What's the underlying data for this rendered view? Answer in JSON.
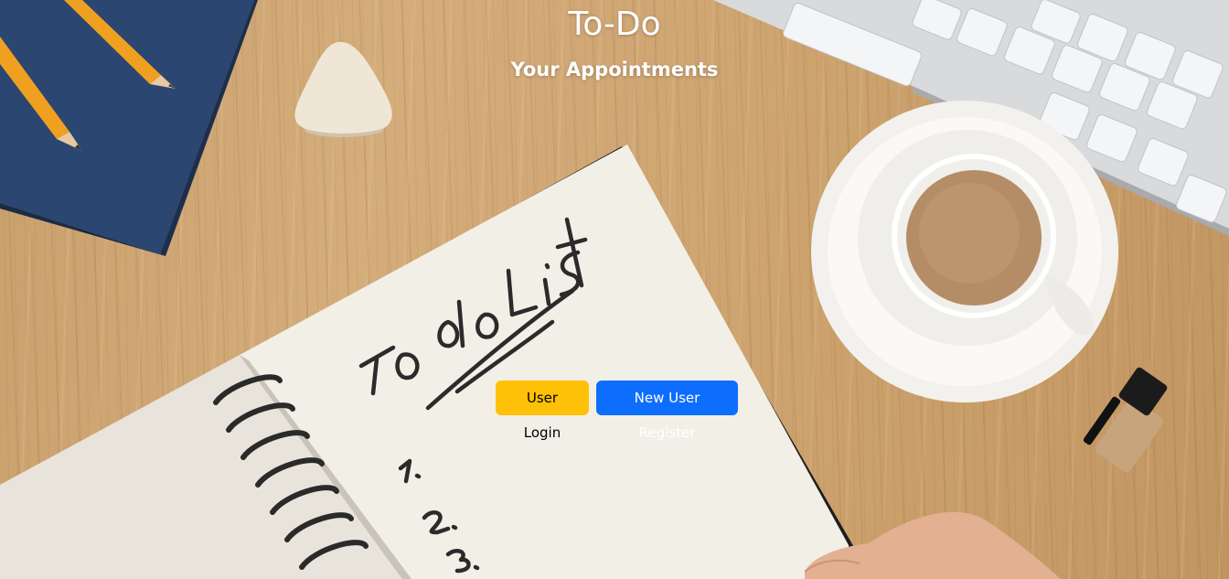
{
  "header": {
    "title": "To-Do",
    "subtitle": "Your Appointments"
  },
  "actions": {
    "login_label": "User Login",
    "register_label": "New User Register"
  },
  "notebook": {
    "handwritten_heading": "to do List",
    "items": [
      "1.",
      "2.",
      "3."
    ]
  },
  "colors": {
    "login_button": "#ffc107",
    "register_button": "#0d6efd",
    "heading_text": "#ffffff"
  }
}
